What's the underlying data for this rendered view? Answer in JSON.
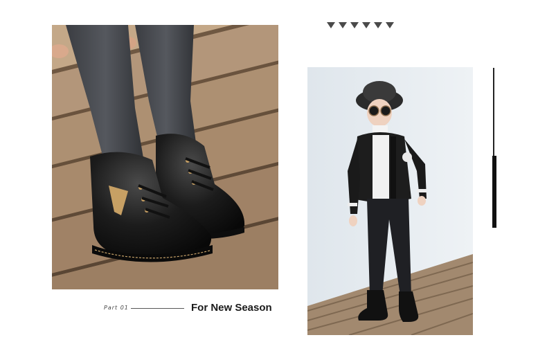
{
  "decor": {
    "triangle_color": "#4a4a4a",
    "triangle_count": 6
  },
  "caption": {
    "part": "Part 01",
    "title": "For New Season"
  },
  "photos": {
    "left": {
      "icon": "boots-closeup-image"
    },
    "right": {
      "icon": "child-model-image"
    }
  }
}
